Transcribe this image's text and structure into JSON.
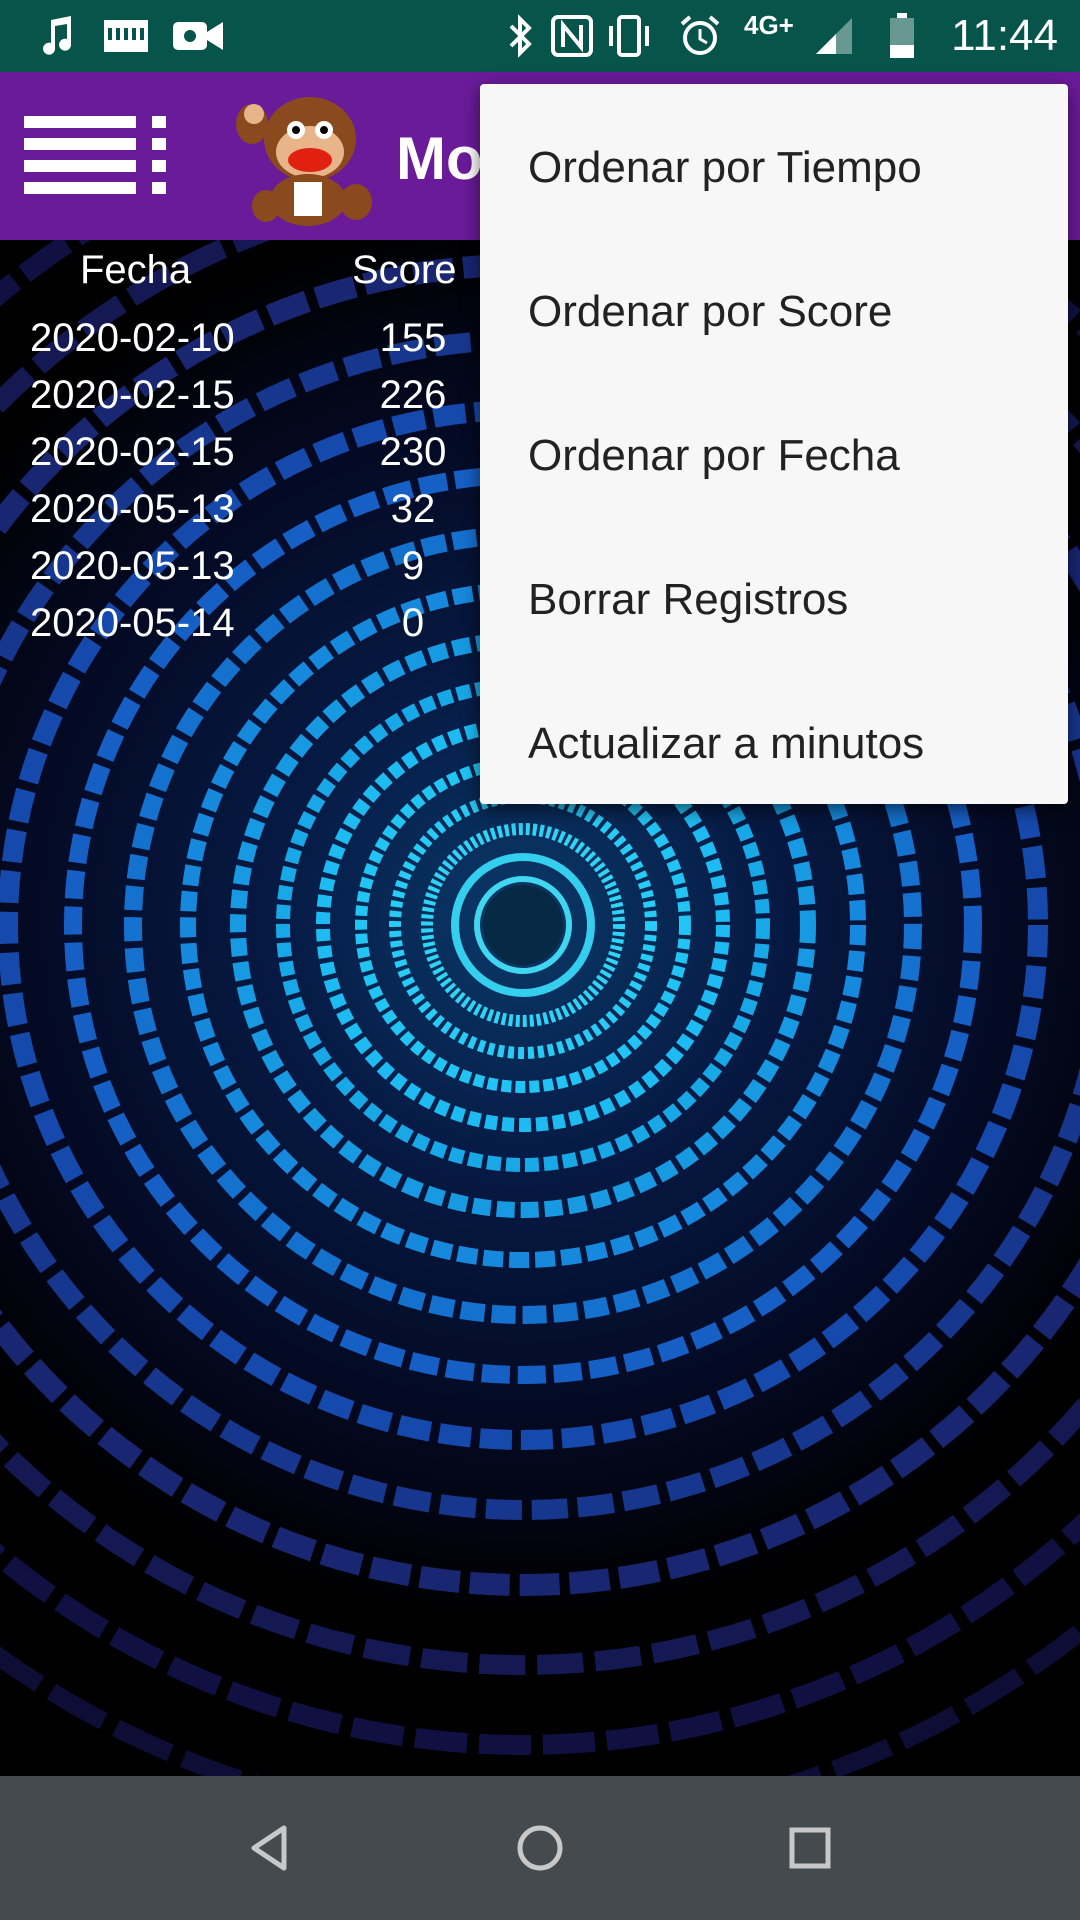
{
  "status_bar": {
    "time": "11:44",
    "network": "4G+",
    "icons": [
      "music-icon",
      "keyboard-icon",
      "video-camera-icon",
      "bluetooth-icon",
      "nfc-icon",
      "vibrate-icon",
      "alarm-icon",
      "signal-icon",
      "battery-icon"
    ]
  },
  "app_bar": {
    "title": "Mo",
    "menu_icon": "menu-icon",
    "mascot_icon": "monkey-mascot-icon",
    "color": "#6a1b9a"
  },
  "table": {
    "headers": {
      "date": "Fecha",
      "score": "Score"
    },
    "rows": [
      {
        "date": "2020-02-10",
        "score": "155"
      },
      {
        "date": "2020-02-15",
        "score": "226"
      },
      {
        "date": "2020-02-15",
        "score": "230"
      },
      {
        "date": "2020-05-13",
        "score": "32"
      },
      {
        "date": "2020-05-13",
        "score": "9"
      },
      {
        "date": "2020-05-14",
        "score": "0"
      }
    ]
  },
  "popup_menu": {
    "items": [
      {
        "label": "Ordenar por Tiempo"
      },
      {
        "label": "Ordenar por Score"
      },
      {
        "label": "Ordenar por Fecha"
      },
      {
        "label": "Borrar Registros"
      },
      {
        "label": "Actualizar a minutos"
      }
    ]
  },
  "nav_bar": {
    "icons": [
      "back-icon",
      "home-icon",
      "recents-icon"
    ]
  },
  "colors": {
    "status_bar": "#06544a",
    "app_bar": "#6a1b9a",
    "nav_bar": "#454a4e",
    "menu_bg": "#f7f7f7",
    "accent_blue": "#1ec8ff"
  }
}
